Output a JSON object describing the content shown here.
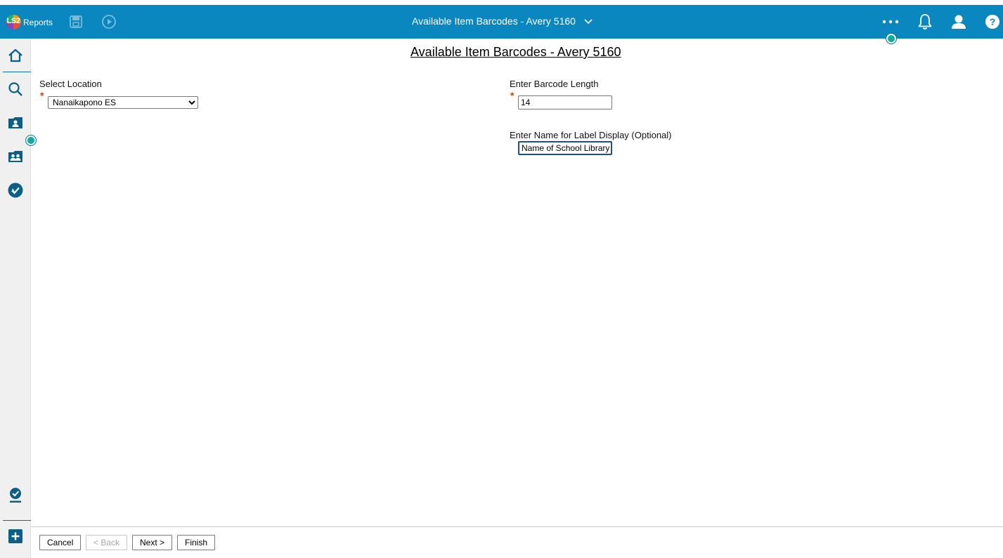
{
  "app": {
    "logo_mark": "LS2",
    "logo_text": "Reports",
    "title": "Available Item Barcodes - Avery 5160",
    "colors": {
      "header": "#0a87be",
      "accent": "#14a8a0",
      "required": "#d93d00"
    }
  },
  "header_icons": [
    "save-icon",
    "play-icon",
    "more-icon",
    "bell-icon",
    "user-icon",
    "help-icon"
  ],
  "help_glyph": "?",
  "sidebar": [
    "home-icon",
    "search-icon",
    "patron-icon",
    "patrons-icon",
    "circulation-icon",
    "approve-icon",
    "add-icon"
  ],
  "form": {
    "title": "Available Item Barcodes - Avery 5160",
    "location_label": "Select Location",
    "location_value": "Nanaikapono ES",
    "barcode_length_label": "Enter Barcode Length",
    "barcode_length_value": "14",
    "label_name_label": "Enter Name for Label Display (Optional)",
    "label_name_value": "Name of School Library",
    "required_mark": "*"
  },
  "footer": {
    "cancel": "Cancel",
    "back": "< Back",
    "next": "Next >",
    "finish": "Finish"
  }
}
